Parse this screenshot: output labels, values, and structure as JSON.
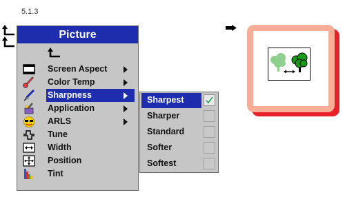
{
  "section_number": "5.1.3",
  "menu": {
    "title": "Picture",
    "items": [
      {
        "label": "",
        "icon": "return-arrow-icon",
        "has_submenu": false
      },
      {
        "label": "Screen Aspect",
        "icon": "screen-aspect-icon",
        "has_submenu": true
      },
      {
        "label": "Color Temp",
        "icon": "thermometer-icon",
        "has_submenu": true
      },
      {
        "label": "Sharpness",
        "icon": "pen-nib-icon",
        "has_submenu": true,
        "selected": true
      },
      {
        "label": "Application",
        "icon": "application-icon",
        "has_submenu": true
      },
      {
        "label": "ARLS",
        "icon": "face-glasses-icon",
        "has_submenu": true
      },
      {
        "label": "Tune",
        "icon": "tune-wave-icon",
        "has_submenu": false
      },
      {
        "label": "Width",
        "icon": "width-icon",
        "has_submenu": false
      },
      {
        "label": "Position",
        "icon": "position-icon",
        "has_submenu": false
      },
      {
        "label": "Tint",
        "icon": "tint-bars-icon",
        "has_submenu": false
      }
    ]
  },
  "submenu": {
    "items": [
      {
        "label": "Sharpest",
        "checked": true
      },
      {
        "label": "Sharper",
        "checked": false
      },
      {
        "label": "Standard",
        "checked": false
      },
      {
        "label": "Softer",
        "checked": false
      },
      {
        "label": "Softest",
        "checked": false
      }
    ]
  },
  "colors": {
    "menu_blue": "#1d2dae",
    "menu_gray": "#c6c6c6",
    "frame_salmon": "#f7ad96",
    "frame_shadow_red": "#e8202a",
    "tree_green": "#1a9a1a",
    "tree_light_green": "#8fd08f"
  },
  "preview": {
    "icon": "sharpness-trees-icon"
  }
}
